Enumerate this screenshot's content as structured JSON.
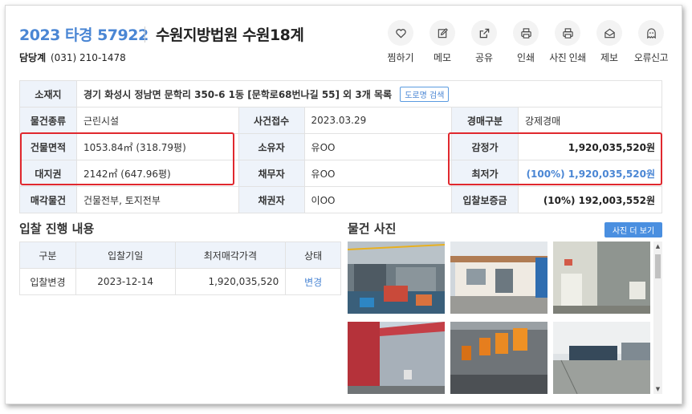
{
  "header": {
    "case_no": "2023 타경 57922",
    "court": "수원지방법원 수원18계",
    "dept_label": "담당계",
    "dept_phone": "(031) 210-1478"
  },
  "actions": [
    {
      "label": "찜하기",
      "icon": "heart-icon"
    },
    {
      "label": "메모",
      "icon": "pencil-icon"
    },
    {
      "label": "공유",
      "icon": "share-icon"
    },
    {
      "label": "인쇄",
      "icon": "printer-icon"
    },
    {
      "label": "사진 인쇄",
      "icon": "printer-icon"
    },
    {
      "label": "제보",
      "icon": "envelope-icon"
    },
    {
      "label": "오류신고",
      "icon": "ghost-icon"
    }
  ],
  "info": {
    "location_label": "소재지",
    "location_value": "경기 화성시 정남면 문학리 350-6 1동 [문학로68번나길 55] 외 3개 목록",
    "road_btn": "도로명 검색",
    "type_label": "물건종류",
    "type_value": "근린시설",
    "received_label": "사건접수",
    "received_value": "2023.03.29",
    "auction_type_label": "경매구분",
    "auction_type_value": "강제경매",
    "building_area_label": "건물면적",
    "building_area_value": "1053.84㎡ (318.79평)",
    "owner_label": "소유자",
    "owner_value": "유OO",
    "appraisal_label": "감정가",
    "appraisal_value": "1,920,035,520원",
    "land_label": "대지권",
    "land_value": "2142㎡ (647.96평)",
    "debtor_label": "채무자",
    "debtor_value": "유OO",
    "min_label": "최저가",
    "min_value": "(100%) 1,920,035,520원",
    "sale_label": "매각물건",
    "sale_value": "건물전부, 토지전부",
    "creditor_label": "채권자",
    "creditor_value": "이OO",
    "deposit_label": "입찰보증금",
    "deposit_value": "(10%) 192,003,552원"
  },
  "bid_section": {
    "title": "입찰 진행 내용",
    "headers": [
      "구분",
      "입찰기일",
      "최저매각가격",
      "상태"
    ],
    "rows": [
      [
        "입찰변경",
        "2023-12-14",
        "1,920,035,520",
        "변경"
      ]
    ]
  },
  "photo_section": {
    "title": "물건 사진",
    "more_btn": "사진 더 보기"
  },
  "colors": {
    "accent": "#4a86d4",
    "highlight_border": "#e0282e",
    "label_bg": "#eef3fa"
  }
}
